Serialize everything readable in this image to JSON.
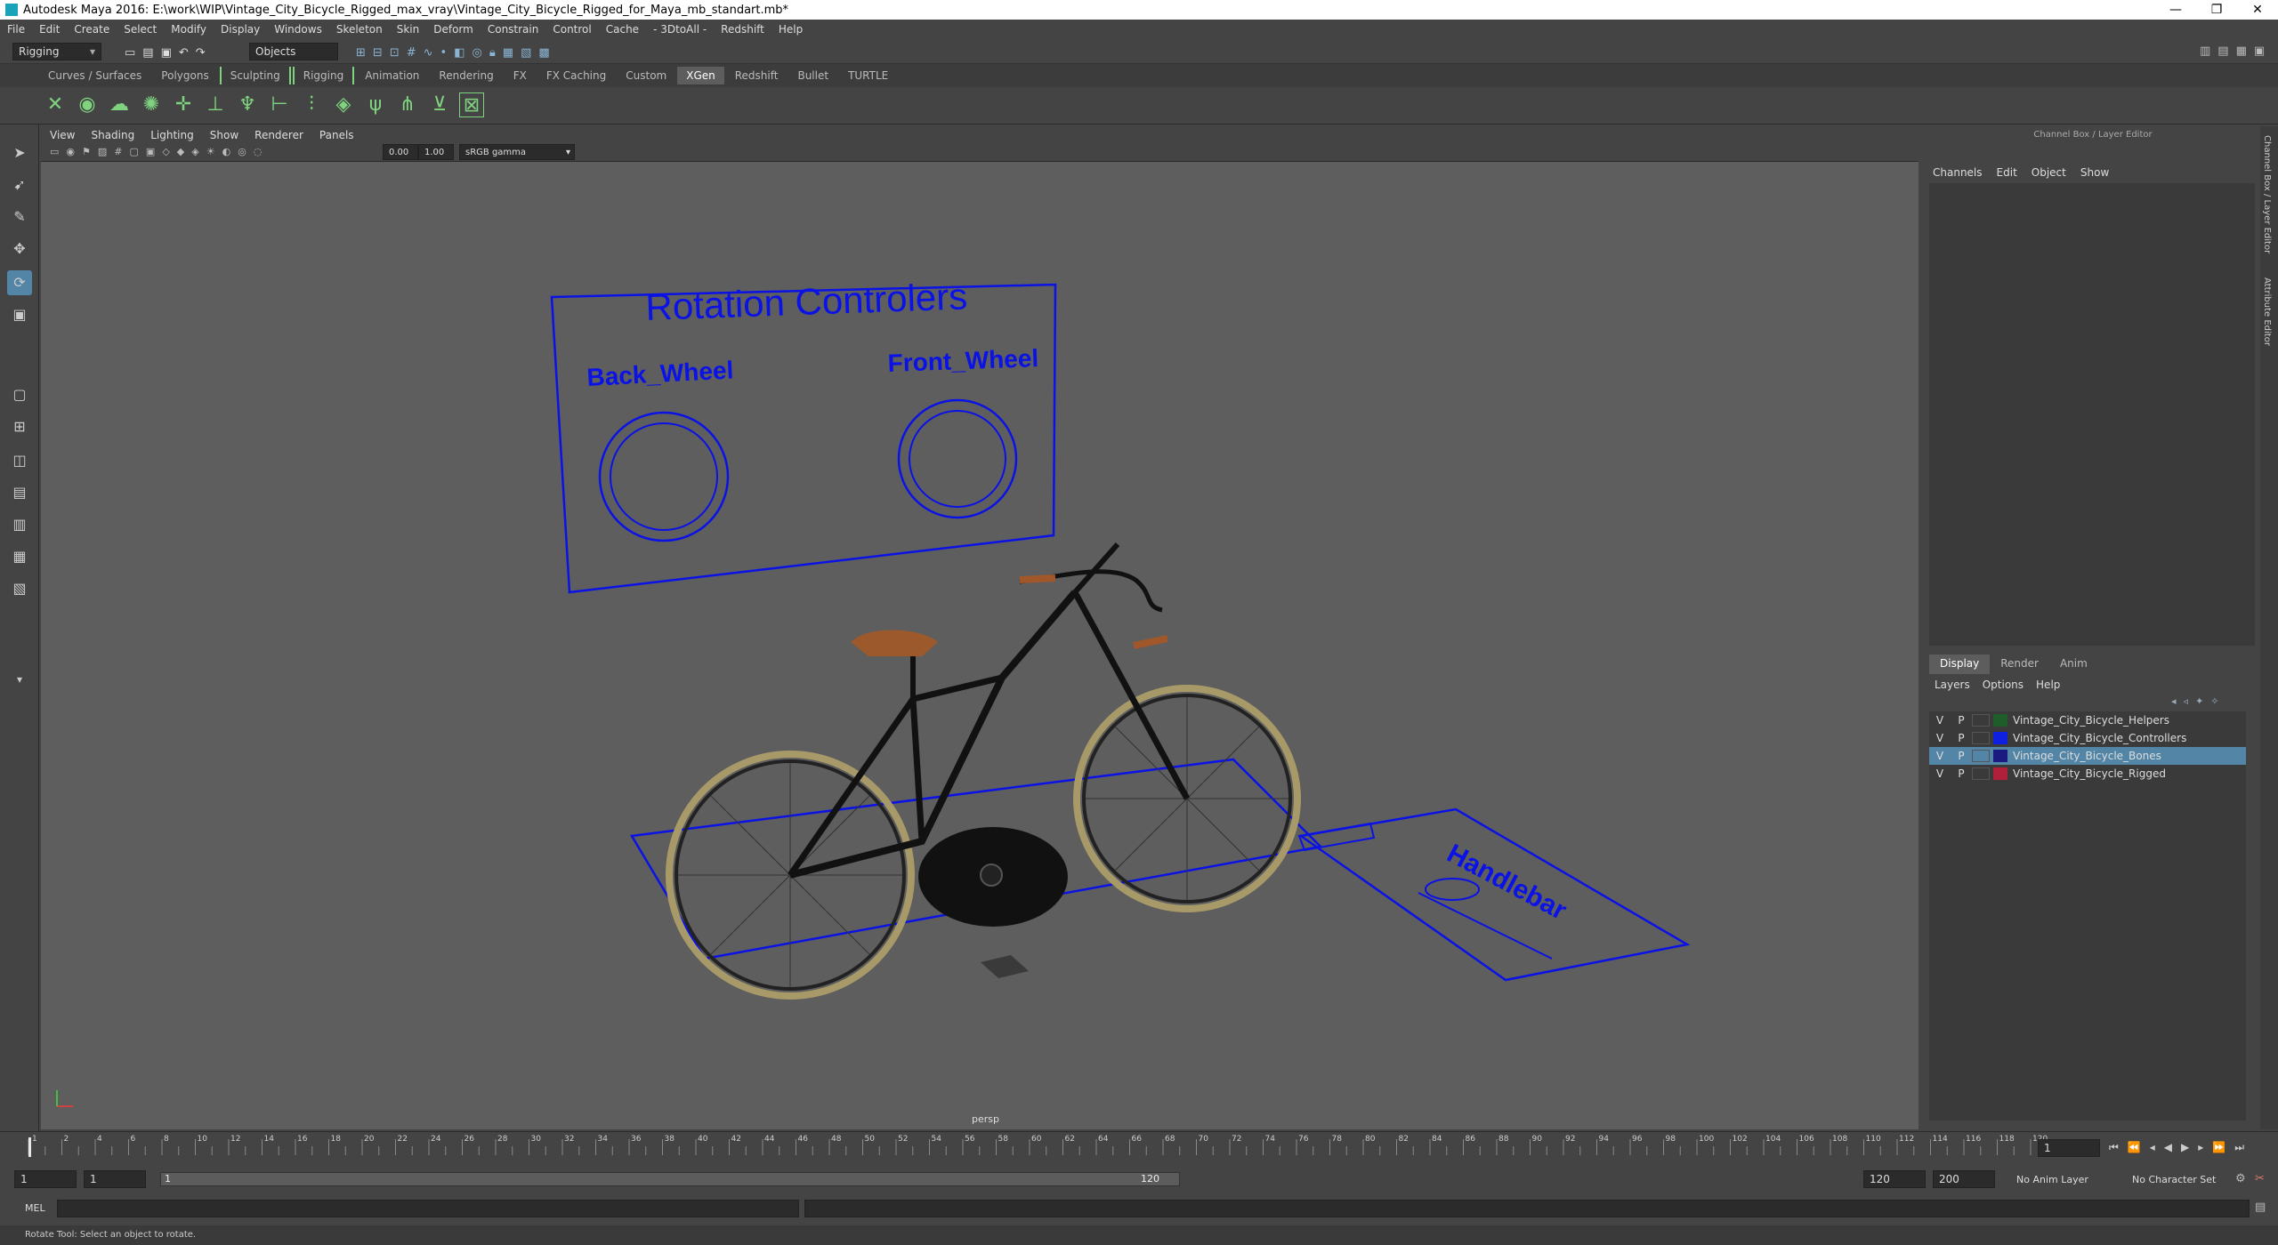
{
  "window": {
    "title": "Autodesk Maya 2016: E:\\work\\WIP\\Vintage_City_Bicycle_Rigged_max_vray\\Vintage_City_Bicycle_Rigged_for_Maya_mb_standart.mb*",
    "minimize": "—",
    "maximize": "❐",
    "close": "✕"
  },
  "menubar": [
    "File",
    "Edit",
    "Create",
    "Select",
    "Modify",
    "Display",
    "Windows",
    "Skeleton",
    "Skin",
    "Deform",
    "Constrain",
    "Control",
    "Cache",
    "- 3DtoAll -",
    "Redshift",
    "Help"
  ],
  "status": {
    "menuset": "Rigging",
    "select_mode": "Objects"
  },
  "shelf_tabs": [
    "Curves / Surfaces",
    "Polygons",
    "Sculpting",
    "Rigging",
    "Animation",
    "Rendering",
    "FX",
    "FX Caching",
    "Custom",
    "XGen",
    "Redshift",
    "Bullet",
    "TURTLE"
  ],
  "shelf_active": "XGen",
  "viewport_menu": [
    "View",
    "Shading",
    "Lighting",
    "Show",
    "Renderer",
    "Panels"
  ],
  "viewport_toolbar": {
    "val1": "0.00",
    "val2": "1.00",
    "colorspace": "sRGB gamma"
  },
  "viewport": {
    "camera": "persp",
    "ctrl_board_title": "Rotation Controlers",
    "ctrl_back": "Back_Wheel",
    "ctrl_front": "Front_Wheel",
    "handlebar_label": "Handlebar",
    "wire_color": "#0a12e6",
    "bg_color": "#5e5e5e"
  },
  "channel_box": {
    "title": "Channel Box / Layer Editor",
    "menu": [
      "Channels",
      "Edit",
      "Object",
      "Show"
    ]
  },
  "layer_editor": {
    "tabs": [
      "Display",
      "Render",
      "Anim"
    ],
    "menu": [
      "Layers",
      "Options",
      "Help"
    ],
    "layers": [
      {
        "v": "V",
        "p": "P",
        "name": "Vintage_City_Bicycle_Helpers",
        "color": "#1f5e2a",
        "selected": false
      },
      {
        "v": "V",
        "p": "P",
        "name": "Vintage_City_Bicycle_Controllers",
        "color": "#1020e0",
        "selected": false
      },
      {
        "v": "V",
        "p": "P",
        "name": "Vintage_City_Bicycle_Bones",
        "color": "#1a1a80",
        "selected": true
      },
      {
        "v": "V",
        "p": "P",
        "name": "Vintage_City_Bicycle_Rigged",
        "color": "#b0203a",
        "selected": false
      }
    ]
  },
  "side_tabs": [
    "Channel Box / Layer Editor",
    "Attribute Editor"
  ],
  "timeline": {
    "ticks": [
      "2",
      "4",
      "6",
      "8",
      "10",
      "12",
      "14",
      "16",
      "18",
      "20",
      "22",
      "24",
      "26",
      "28",
      "30",
      "32",
      "34",
      "36",
      "38",
      "40",
      "42",
      "44",
      "46",
      "48",
      "50",
      "52",
      "54",
      "56",
      "58",
      "60",
      "62",
      "64",
      "66",
      "68",
      "70",
      "72",
      "74",
      "76",
      "78",
      "80",
      "82",
      "84",
      "86",
      "88",
      "90",
      "92",
      "94",
      "96",
      "98",
      "100",
      "102",
      "104",
      "106",
      "108",
      "110",
      "112",
      "114",
      "116",
      "118",
      "120"
    ],
    "current_frame": "1",
    "first_tick": "1"
  },
  "range": {
    "start": "1",
    "start_inner": "1",
    "slider_left": "1",
    "slider_right": "120",
    "end_inner": "120",
    "end": "200",
    "anim_layer": "No Anim Layer",
    "char_set": "No Character Set"
  },
  "command": {
    "lang": "MEL"
  },
  "help_line": "Rotate Tool: Select an object to rotate."
}
